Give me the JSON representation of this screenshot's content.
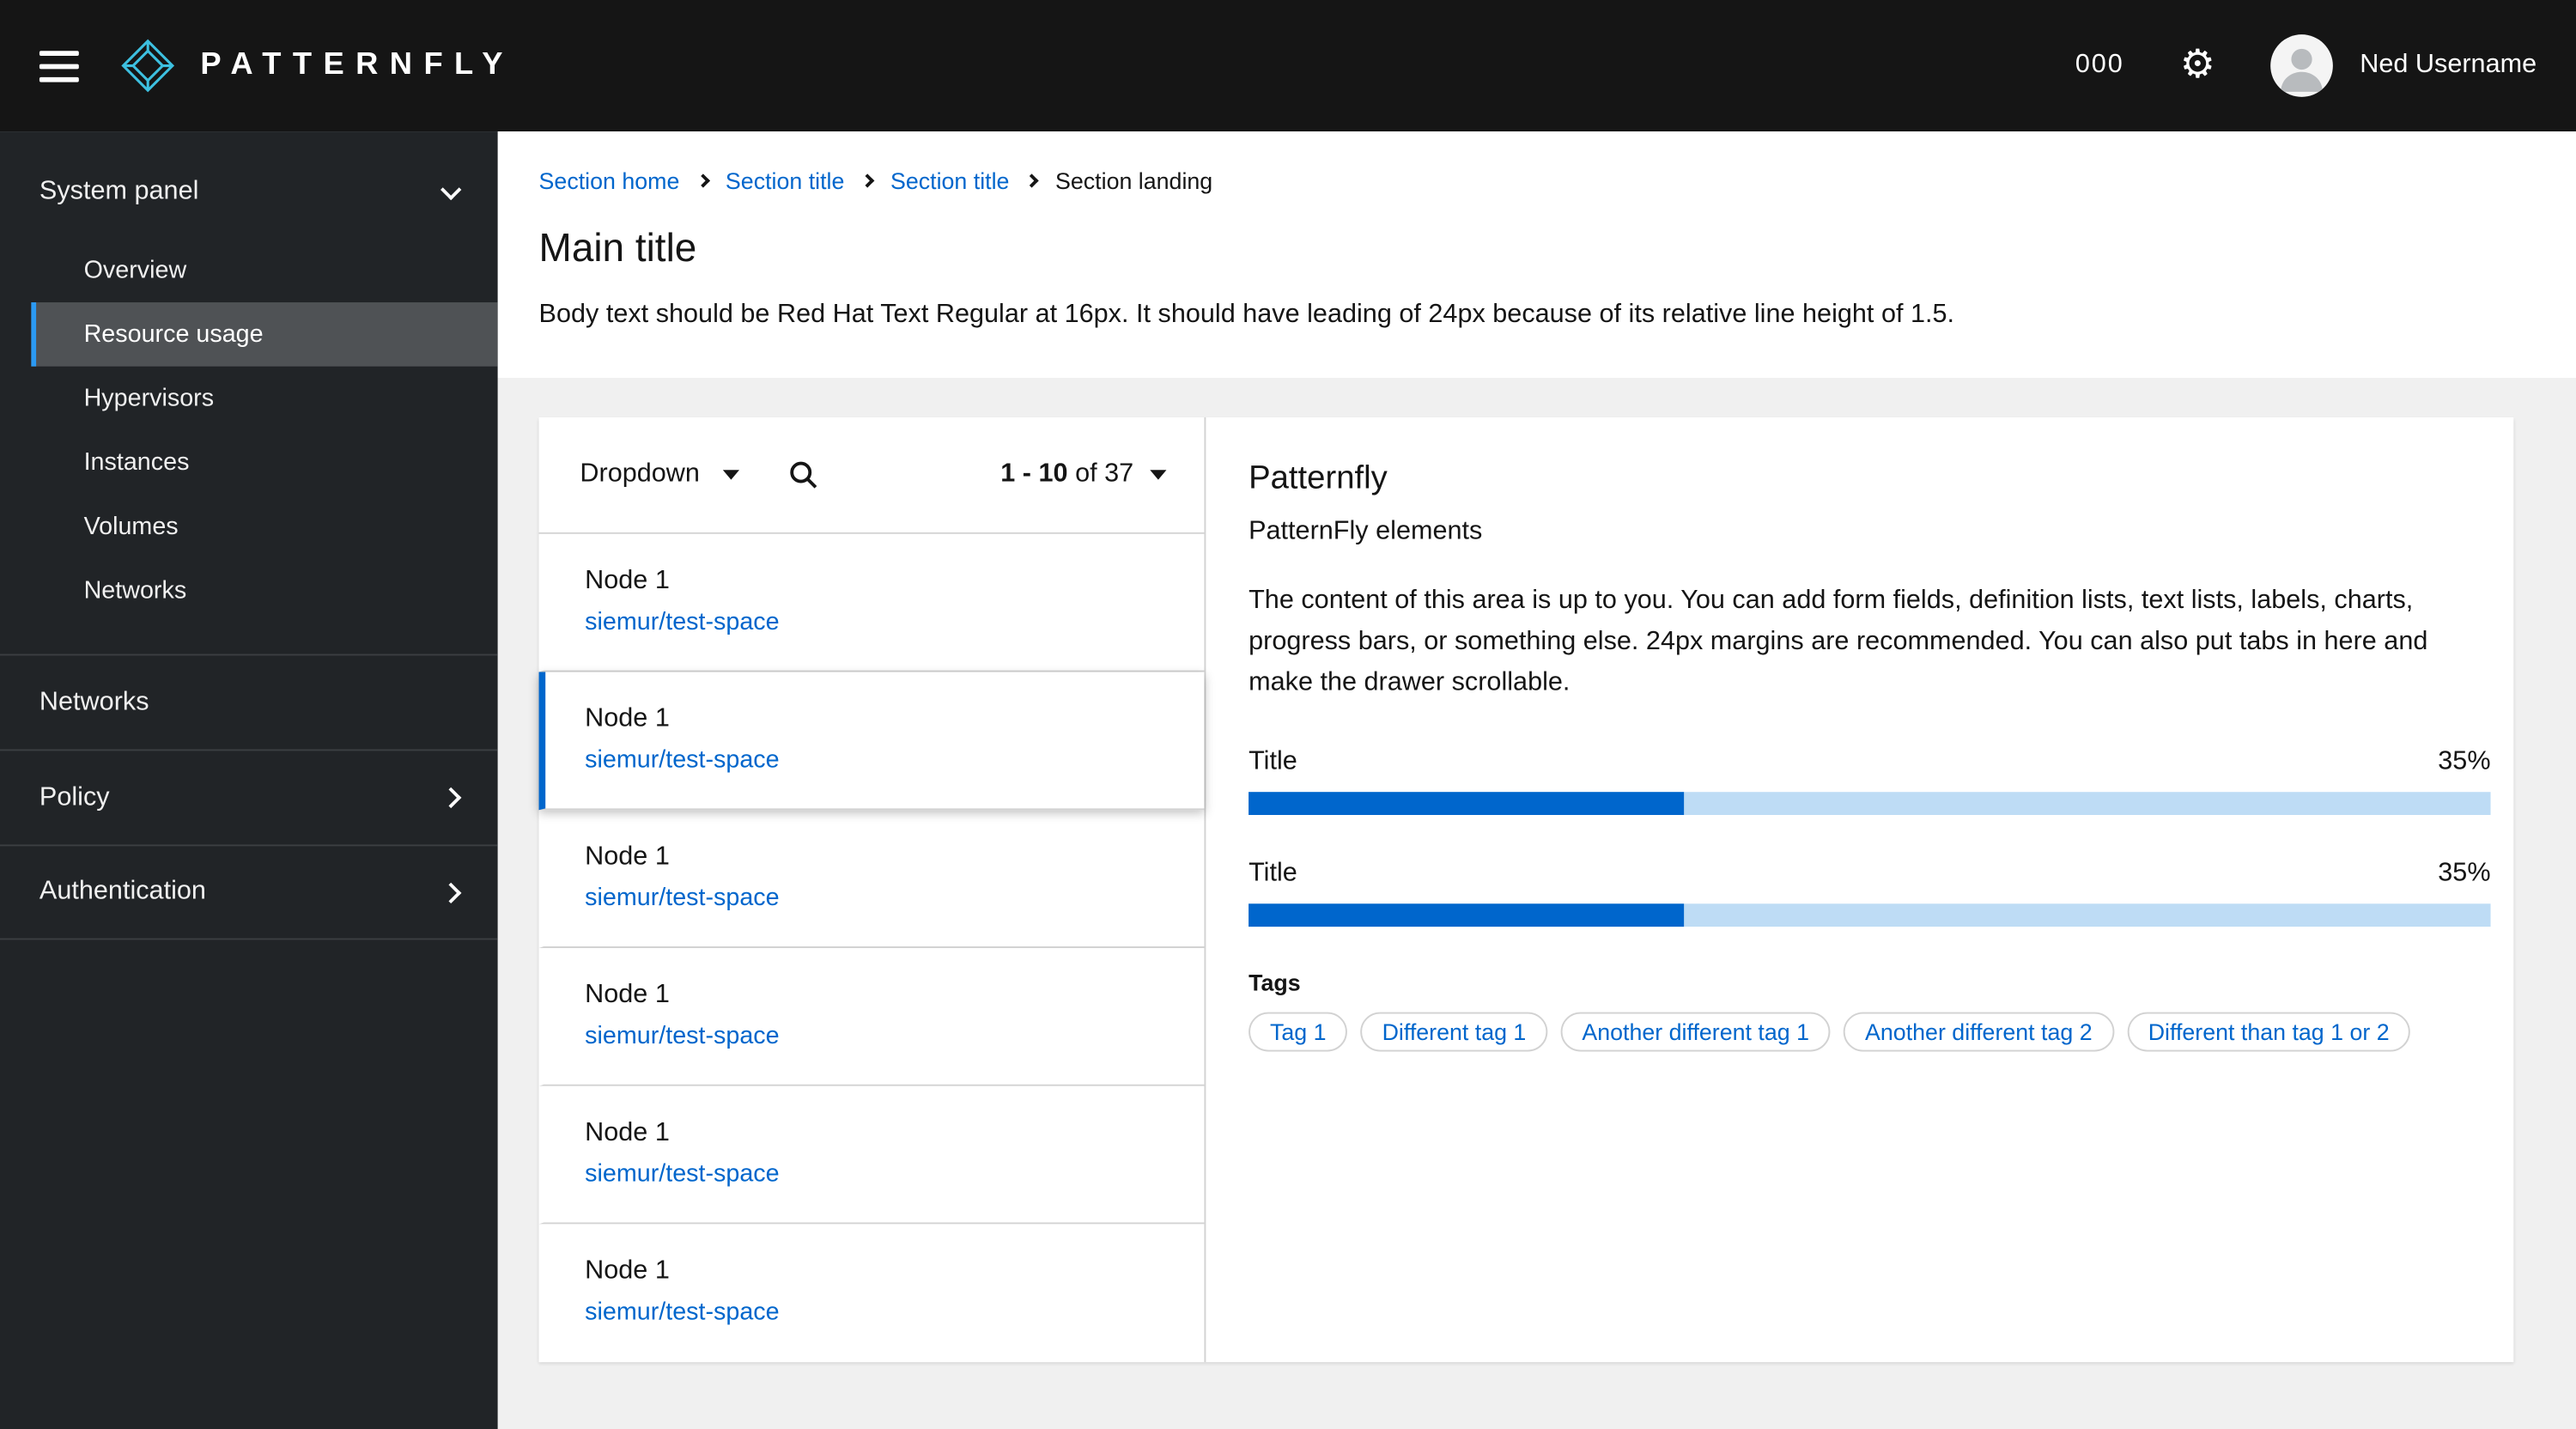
{
  "masthead": {
    "brand": "PATTERNFLY",
    "counter": "000",
    "username": "Ned Username"
  },
  "sidebar": {
    "system_panel": {
      "label": "System panel"
    },
    "panel_items": [
      {
        "label": "Overview"
      },
      {
        "label": "Resource usage"
      },
      {
        "label": "Hypervisors"
      },
      {
        "label": "Instances"
      },
      {
        "label": "Volumes"
      },
      {
        "label": "Networks"
      }
    ],
    "sections": [
      {
        "label": "Networks"
      },
      {
        "label": "Policy"
      },
      {
        "label": "Authentication"
      }
    ]
  },
  "breadcrumb": {
    "items": [
      {
        "label": "Section home"
      },
      {
        "label": "Section title"
      },
      {
        "label": "Section title"
      },
      {
        "label": "Section landing"
      }
    ]
  },
  "page": {
    "title": "Main title",
    "body": "Body text should be Red Hat Text Regular at 16px. It should have leading of 24px because of its relative line height of 1.5."
  },
  "toolbar": {
    "dropdown_label": "Dropdown",
    "pagination_range": "1 - 10",
    "pagination_of": "of 37"
  },
  "list": {
    "items": [
      {
        "title": "Node 1",
        "link": "siemur/test-space"
      },
      {
        "title": "Node 1",
        "link": "siemur/test-space"
      },
      {
        "title": "Node 1",
        "link": "siemur/test-space"
      },
      {
        "title": "Node 1",
        "link": "siemur/test-space"
      },
      {
        "title": "Node 1",
        "link": "siemur/test-space"
      },
      {
        "title": "Node 1",
        "link": "siemur/test-space"
      }
    ]
  },
  "drawer": {
    "title": "Patternfly",
    "subtitle": "PatternFly elements",
    "body": "The content of this area is up to you. You can add form fields, definition lists, text lists, labels, charts, progress bars, or something else. 24px margins are recommended. You can also put tabs in here and make the drawer scrollable.",
    "progress": [
      {
        "label": "Title",
        "value": "35%",
        "percent": 35
      },
      {
        "label": "Title",
        "value": "35%",
        "percent": 35
      }
    ],
    "tags_label": "Tags",
    "tags": [
      {
        "label": "Tag 1"
      },
      {
        "label": "Different tag 1"
      },
      {
        "label": "Another different tag 1"
      },
      {
        "label": "Another different tag 2"
      },
      {
        "label": "Different than tag 1 or 2"
      }
    ]
  },
  "colors": {
    "primary": "#0066cc",
    "masthead_bg": "#151515",
    "sidebar_bg": "#212427",
    "nav_selected_bg": "#4f5255",
    "nav_accent": "#2b9af3",
    "progress_track": "#bedcf5",
    "content_bg": "#f0f0f0"
  }
}
